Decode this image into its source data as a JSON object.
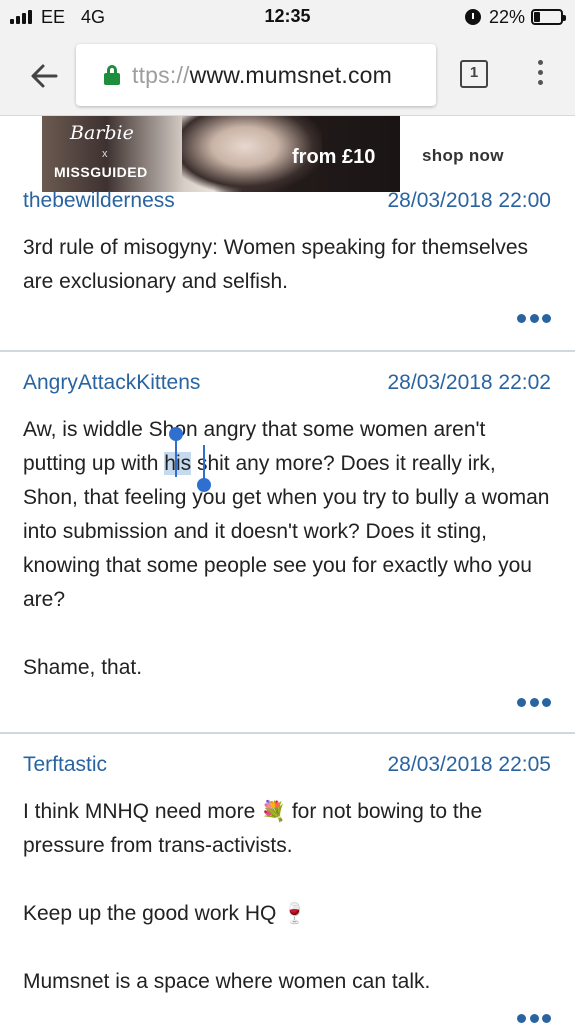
{
  "status_bar": {
    "carrier": "EE",
    "network": "4G",
    "time": "12:35",
    "battery": "22%",
    "battery_level": 0.22
  },
  "browser": {
    "url_scheme": "https://",
    "url_visible_scheme": "ttps://",
    "url_host": "www.mumsnet.com",
    "tab_count": "1",
    "lock_color": "#1e8e3e"
  },
  "ad": {
    "brand_line1": "Barbie",
    "brand_x": "x",
    "brand_line2": "MISSGUIDED",
    "price": "from £10",
    "cta": "shop now"
  },
  "colors": {
    "accent": "#2a64a0",
    "divider": "#cdd8e1",
    "selection": "#c5d9ef",
    "handle": "#2f6fd0"
  },
  "posts": [
    {
      "author": "thebewilderness",
      "date": "28/03/2018 22:00",
      "paragraphs": [
        "3rd rule of misogyny: Women speaking for themselves are exclusionary and selfish."
      ]
    },
    {
      "author": "AngryAttackKittens",
      "date": "28/03/2018 22:02",
      "p1_before": "Aw, is widdle Shon angry that some women aren't putting up with ",
      "p1_selected": "his",
      "p1_after": " shit any more? Does it really irk, Shon, that feeling you get when you try to bully a woman into submission and it doesn't work? Does it sting, knowing that some people see you for exactly who you are?",
      "p2": "Shame, that."
    },
    {
      "author": "Terftastic",
      "date": "28/03/2018 22:05",
      "p1_before": "I think MNHQ need more ",
      "p1_emoji": "💐",
      "p1_after": " for not bowing to the pressure from trans-activists.",
      "p2_before": "Keep up the good work HQ ",
      "p2_emoji": "🍷",
      "p3": "Mumsnet is a space where women can talk."
    }
  ]
}
